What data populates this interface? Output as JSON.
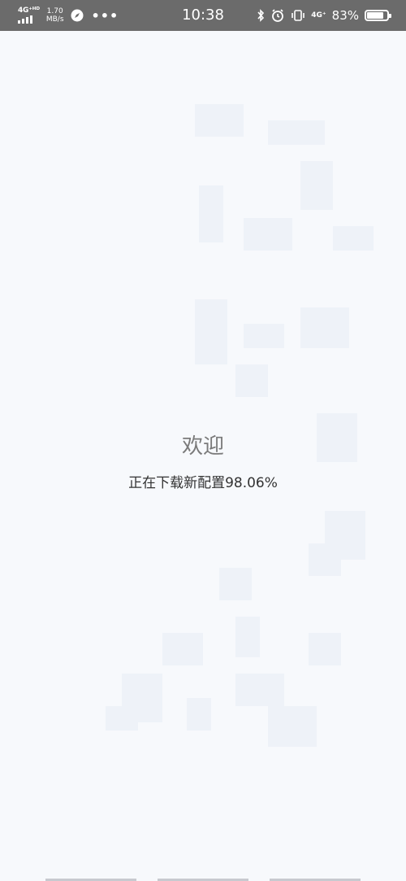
{
  "status_bar": {
    "network_left": "4G⁺ᴴᴰ",
    "speed_value": "1.70",
    "speed_unit": "MB/s",
    "more": "•••",
    "time": "10:38",
    "network_right": "4G⁺",
    "battery_percent": "83%",
    "battery_level": 0.83,
    "icons": [
      "signal-icon",
      "navigation-compass-icon",
      "bluetooth-icon",
      "alarm-icon",
      "vibrate-icon",
      "battery-icon"
    ]
  },
  "main": {
    "welcome": "欢迎",
    "status": "正在下载新配置98.06%",
    "progress_percent": 98.06
  },
  "colors": {
    "status_bar_bg": "#6b6b6b",
    "page_bg": "#f7f9fc",
    "welcome_text": "#7a7a7a",
    "status_text": "#333333"
  }
}
